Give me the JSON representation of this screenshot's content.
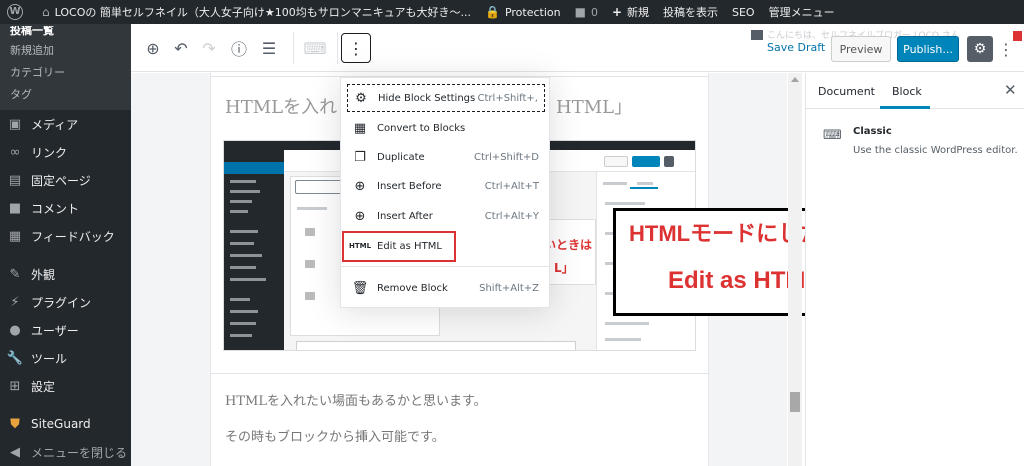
{
  "admin_bar": {
    "site_title": "LOCOの 簡単セルフネイル（大人女子向け★100均もサロンマニキュアも大好き〜...",
    "protection": "Protection",
    "comments_count": "0",
    "new_label": "新規",
    "view_post": "投稿を表示",
    "seo": "SEO",
    "admin_menu": "管理メニュー"
  },
  "sidebar": {
    "cut_label": "投稿一覧",
    "submenu": [
      "新規追加",
      "カテゴリー",
      "タグ"
    ],
    "items": [
      {
        "label": "メディア",
        "icon": "media-icon"
      },
      {
        "label": "リンク",
        "icon": "link-icon"
      },
      {
        "label": "固定ページ",
        "icon": "page-icon"
      },
      {
        "label": "コメント",
        "icon": "comment-icon"
      },
      {
        "label": "フィードバック",
        "icon": "feedback-icon"
      },
      {
        "label": "外観",
        "icon": "appearance-icon"
      },
      {
        "label": "プラグイン",
        "icon": "plugin-icon"
      },
      {
        "label": "ユーザー",
        "icon": "user-icon"
      },
      {
        "label": "ツール",
        "icon": "tools-icon"
      },
      {
        "label": "設定",
        "icon": "settings-icon"
      },
      {
        "label": "SiteGuard",
        "icon": "siteguard-icon"
      },
      {
        "label": "メニューを閉じる",
        "icon": "collapse-icon"
      }
    ]
  },
  "toolbar": {
    "save_draft": "Save Draft",
    "preview": "Preview",
    "publish": "Publish...",
    "ghost_notice": "こんにちは、セルフネイルブロガー LOCO さん"
  },
  "dropdown": {
    "items": [
      {
        "label": "Hide Block Settings",
        "shortcut": "Ctrl+Shift+,",
        "icon": "gear-icon"
      },
      {
        "label": "Convert to Blocks",
        "shortcut": "",
        "icon": "grid-icon"
      },
      {
        "label": "Duplicate",
        "shortcut": "Ctrl+Shift+D",
        "icon": "duplicate-icon"
      },
      {
        "label": "Insert Before",
        "shortcut": "Ctrl+Alt+T",
        "icon": "insert-before-icon"
      },
      {
        "label": "Insert After",
        "shortcut": "Ctrl+Alt+Y",
        "icon": "insert-after-icon"
      },
      {
        "label": "Edit as HTML",
        "shortcut": "",
        "icon": "html-icon"
      },
      {
        "label": "Remove Block",
        "shortcut": "Shift+Alt+Z",
        "icon": "trash-icon"
      }
    ]
  },
  "editor": {
    "heading_left": "HTMLを入れ",
    "heading_right": "HTML」",
    "paragraph_lines": [
      "HTMLを入れたい場面もあるかと思います。",
      "その時もブロックから挿入可能です。"
    ]
  },
  "callout": {
    "line1": "HTMLモードにしたい時",
    "line2": "Edit as HTML"
  },
  "embedded_screenshot": {
    "red_text_1": "いときは",
    "red_text_2": "L」"
  },
  "right_panel": {
    "tabs": [
      "Document",
      "Block"
    ],
    "active_tab": "Block",
    "block_title": "Classic",
    "block_description": "Use the classic WordPress editor."
  },
  "colors": {
    "accent": "#0085ba",
    "highlight": "#dc3232",
    "admin_dark": "#23282d"
  }
}
